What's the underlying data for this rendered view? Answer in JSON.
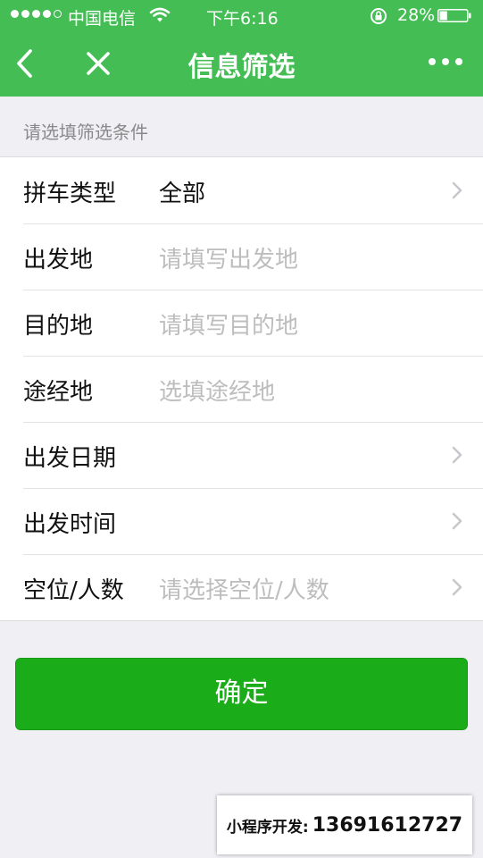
{
  "status_bar": {
    "carrier": "中国电信",
    "time": "下午6:16",
    "battery_percent": "28%",
    "battery_level": 0.28,
    "signal_bars_filled": 4,
    "signal_bars_total": 5
  },
  "nav": {
    "title": "信息筛选",
    "back_icon": "chevron-left-icon",
    "close_icon": "close-icon",
    "more_icon": "more-dots-icon"
  },
  "form": {
    "section_header": "请选填筛选条件",
    "rows": [
      {
        "label": "拼车类型",
        "value": "全部",
        "placeholder": "",
        "has_chevron": true
      },
      {
        "label": "出发地",
        "value": "",
        "placeholder": "请填写出发地",
        "has_chevron": false
      },
      {
        "label": "目的地",
        "value": "",
        "placeholder": "请填写目的地",
        "has_chevron": false
      },
      {
        "label": "途经地",
        "value": "",
        "placeholder": "选填途经地",
        "has_chevron": false
      },
      {
        "label": "出发日期",
        "value": "",
        "placeholder": "",
        "has_chevron": true
      },
      {
        "label": "出发时间",
        "value": "",
        "placeholder": "",
        "has_chevron": true
      },
      {
        "label": "空位/人数",
        "value": "",
        "placeholder": "请选择空位/人数",
        "has_chevron": true
      }
    ]
  },
  "confirm_button": {
    "label": "确定"
  },
  "watermark": {
    "label": "小程序开发:",
    "phone": "13691612727"
  },
  "colors": {
    "nav_green": "#44be54",
    "button_green": "#1aad19",
    "background": "#efeff4",
    "placeholder_gray": "#bdbdbd"
  }
}
